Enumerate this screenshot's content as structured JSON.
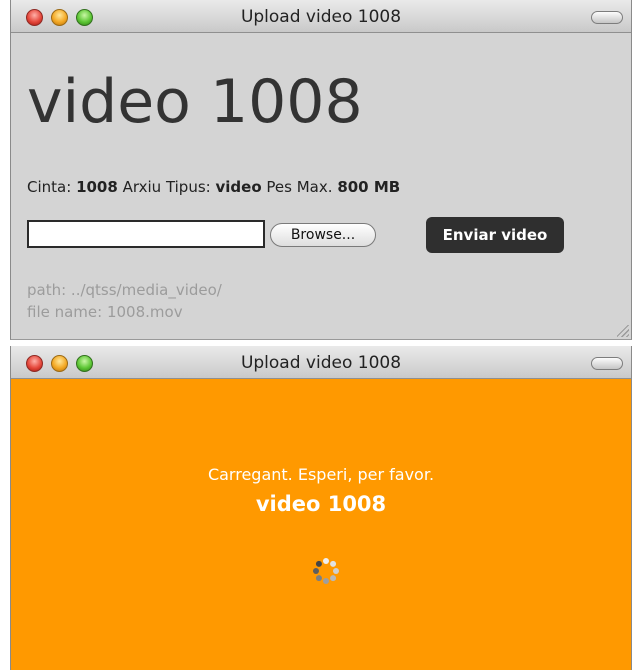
{
  "upload_window": {
    "title": "Upload video 1008",
    "heading": "video 1008",
    "info": {
      "cinta_label": "Cinta:",
      "cinta_value": "1008",
      "tipus_label": "Arxiu Tipus:",
      "tipus_value": "video",
      "pes_label": "Pes Max.",
      "pes_value": "800 MB"
    },
    "file_input_value": "",
    "browse_label": "Browse...",
    "send_label": "Enviar video",
    "path_text": "path: ../qtss/media_video/",
    "file_name_text": "file name: 1008.mov"
  },
  "loading_window": {
    "title": "Upload video 1008",
    "message": "Carregant. Esperi, per favor.",
    "video_title": "video 1008",
    "background_color": "#ff9900"
  },
  "icons": {
    "close": "close-light-icon",
    "minimize": "minimize-light-icon",
    "zoom": "zoom-light-icon",
    "toolbar": "toolbar-toggle-icon",
    "spinner": "loading-spinner-icon",
    "resize": "resize-grip-icon"
  }
}
